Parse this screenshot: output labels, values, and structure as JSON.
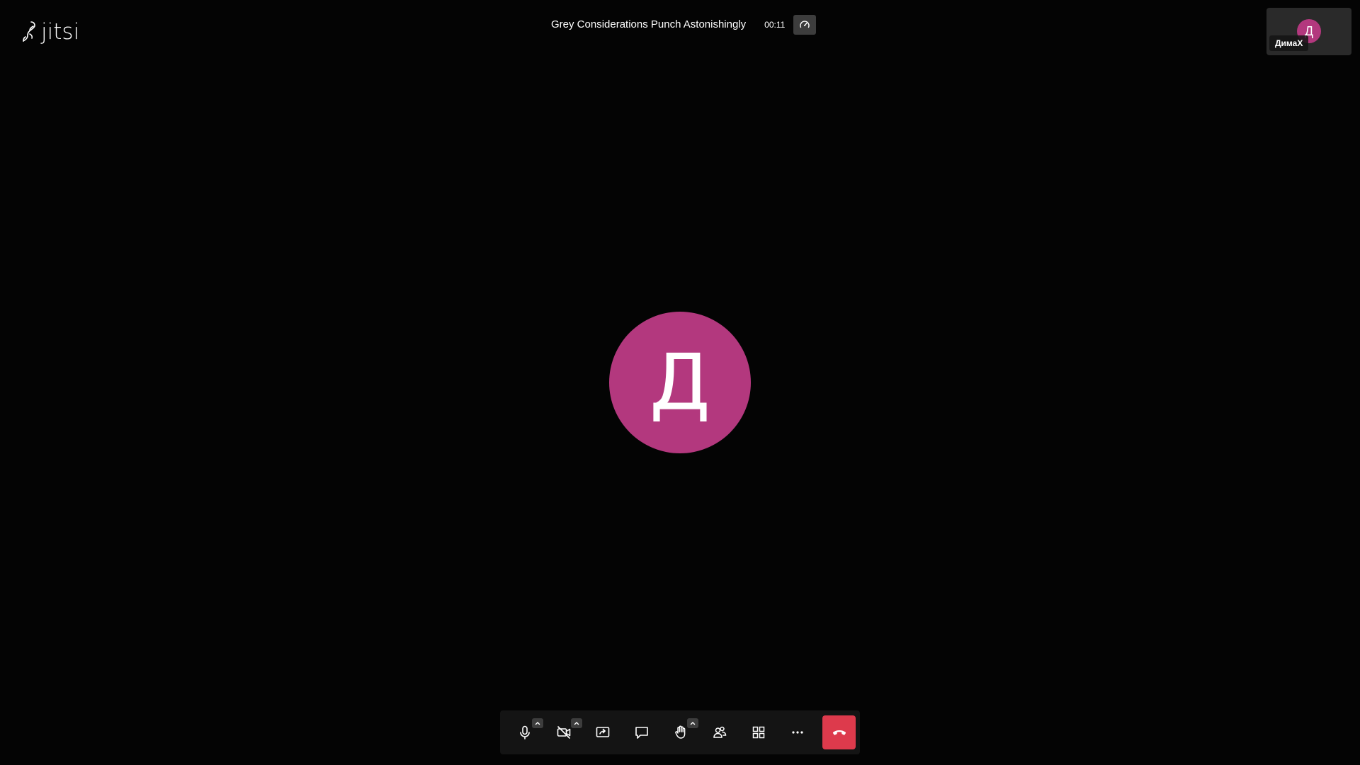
{
  "app": {
    "logo_text": "jitsi"
  },
  "header": {
    "subject": "Grey Considerations Punch Astonishingly",
    "timer": "00:11",
    "stats_icon": "gauge-icon"
  },
  "filmstrip": {
    "local": {
      "avatar_initial": "Д",
      "display_name": "ДимаХ",
      "avatar_color": "#b3387e"
    }
  },
  "stage": {
    "avatar_initial": "Д",
    "avatar_color": "#b3387e"
  },
  "toolbar": {
    "buttons": [
      {
        "name": "microphone-button",
        "icon": "microphone-icon",
        "has_options": true
      },
      {
        "name": "camera-button",
        "icon": "camera-off-icon",
        "has_options": true
      },
      {
        "name": "share-screen-button",
        "icon": "screen-share-icon",
        "has_options": false
      },
      {
        "name": "chat-button",
        "icon": "chat-icon",
        "has_options": false
      },
      {
        "name": "raise-hand-button",
        "icon": "hand-icon",
        "has_options": true
      },
      {
        "name": "participants-button",
        "icon": "participants-icon",
        "has_options": false
      },
      {
        "name": "tile-view-button",
        "icon": "grid-icon",
        "has_options": false
      },
      {
        "name": "more-actions-button",
        "icon": "more-icon",
        "has_options": false
      }
    ],
    "hangup_icon": "hangup-icon",
    "hangup_color": "#dd3a4c"
  }
}
